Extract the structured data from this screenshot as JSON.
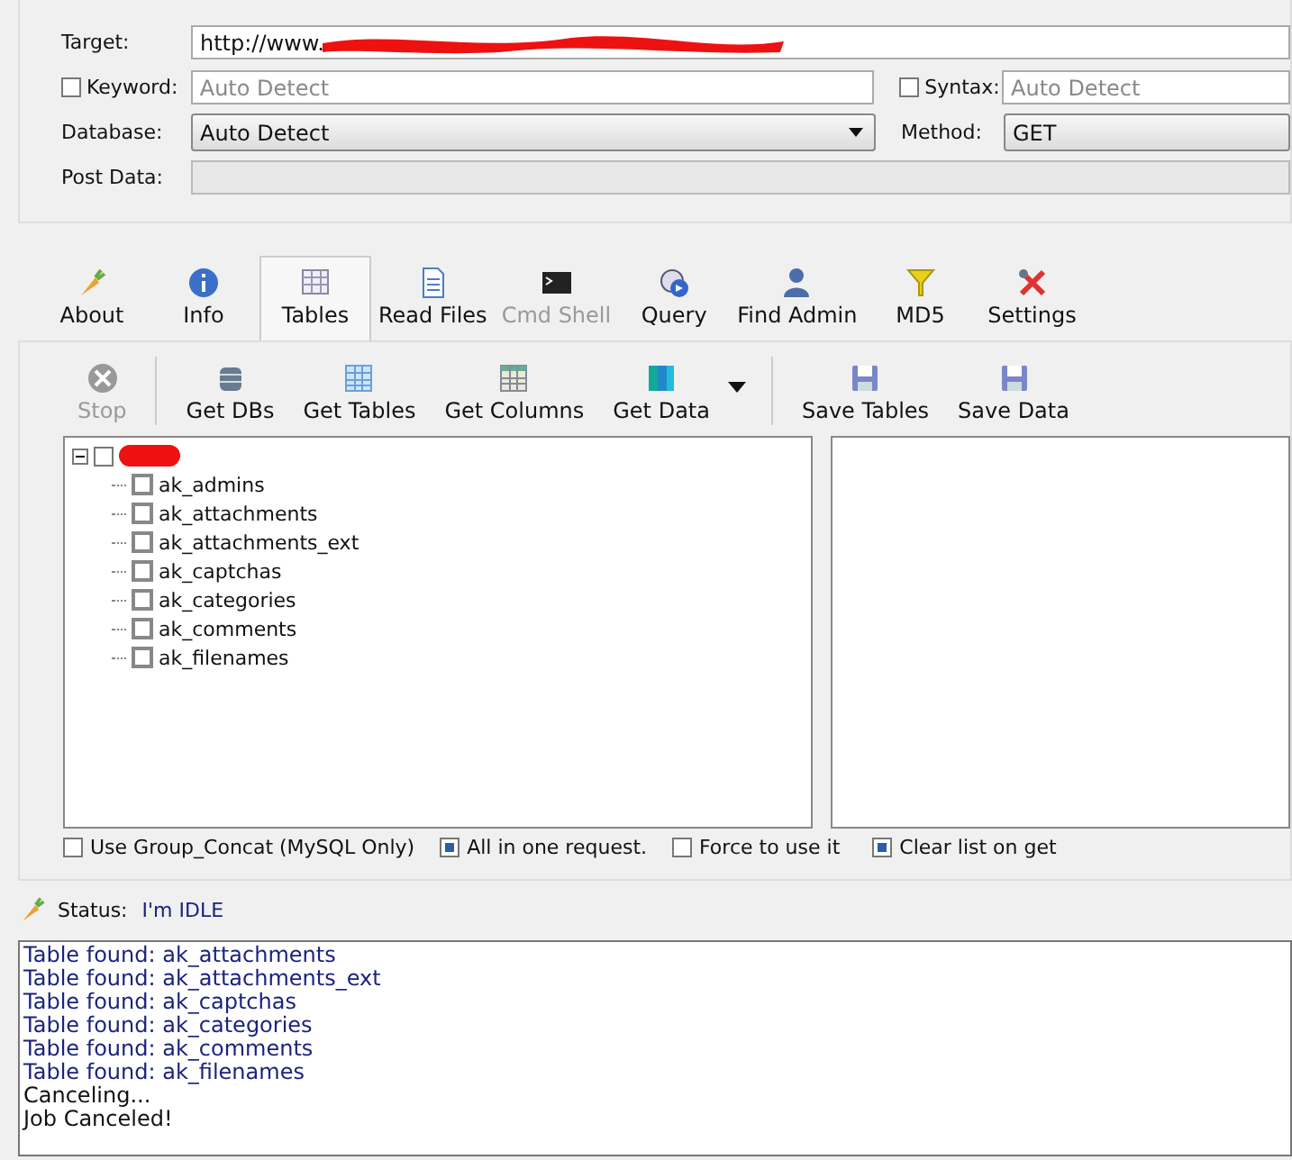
{
  "form": {
    "target": {
      "label": "Target:",
      "value": "http://www."
    },
    "keyword": {
      "label": "Keyword:",
      "checked": false,
      "placeholder": "Auto Detect"
    },
    "syntax": {
      "label": "Syntax:",
      "checked": false,
      "placeholder": "Auto Detect"
    },
    "database": {
      "label": "Database:",
      "value": "Auto Detect"
    },
    "method": {
      "label": "Method:",
      "value": "GET"
    },
    "post_data": {
      "label": "Post Data:",
      "disabled": true
    }
  },
  "tabs": [
    {
      "label": "About",
      "selected": false,
      "disabled": false,
      "kind": "carrot"
    },
    {
      "label": "Info",
      "selected": false,
      "disabled": false,
      "kind": "info"
    },
    {
      "label": "Tables",
      "selected": true,
      "disabled": false,
      "kind": "table"
    },
    {
      "label": "Read Files",
      "selected": false,
      "disabled": false,
      "kind": "file"
    },
    {
      "label": "Cmd Shell",
      "selected": false,
      "disabled": true,
      "kind": "terminal"
    },
    {
      "label": "Query",
      "selected": false,
      "disabled": false,
      "kind": "query"
    },
    {
      "label": "Find Admin",
      "selected": false,
      "disabled": false,
      "kind": "user"
    },
    {
      "label": "MD5",
      "selected": false,
      "disabled": false,
      "kind": "funnel"
    },
    {
      "label": "Settings",
      "selected": false,
      "disabled": false,
      "kind": "tools"
    }
  ],
  "toolbar": [
    {
      "label": "Stop",
      "disabled": true,
      "kind": "stop"
    },
    {
      "kind": "sep"
    },
    {
      "label": "Get DBs",
      "disabled": false,
      "kind": "db"
    },
    {
      "label": "Get Tables",
      "disabled": false,
      "kind": "grid"
    },
    {
      "label": "Get Columns",
      "disabled": false,
      "kind": "columns"
    },
    {
      "label": "Get Data",
      "disabled": false,
      "kind": "data"
    },
    {
      "kind": "dropdown"
    },
    {
      "kind": "sep"
    },
    {
      "label": "Save Tables",
      "disabled": false,
      "kind": "save"
    },
    {
      "label": "Save Data",
      "disabled": false,
      "kind": "save"
    }
  ],
  "tree": {
    "root": {
      "checked": false,
      "expanded": true,
      "redacted": true
    },
    "children": [
      {
        "label": "ak_admins",
        "checked": false
      },
      {
        "label": "ak_attachments",
        "checked": false
      },
      {
        "label": "ak_attachments_ext",
        "checked": false
      },
      {
        "label": "ak_captchas",
        "checked": false
      },
      {
        "label": "ak_categories",
        "checked": false
      },
      {
        "label": "ak_comments",
        "checked": false
      },
      {
        "label": "ak_filenames",
        "checked": false
      }
    ]
  },
  "options": [
    {
      "label": "Use Group_Concat (MySQL Only)",
      "checked": false
    },
    {
      "label": "All in one request.",
      "checked": true
    },
    {
      "label": "Force to use it",
      "checked": false
    },
    {
      "label": "Clear list on get",
      "checked": true
    }
  ],
  "status": {
    "label": "Status:",
    "value": "I'm IDLE"
  },
  "log": [
    {
      "text": "Table found: ak_attachments",
      "kind": "found"
    },
    {
      "text": "Table found: ak_attachments_ext",
      "kind": "found"
    },
    {
      "text": "Table found: ak_captchas",
      "kind": "found"
    },
    {
      "text": "Table found: ak_categories",
      "kind": "found"
    },
    {
      "text": "Table found: ak_comments",
      "kind": "found"
    },
    {
      "text": "Table found: ak_filenames",
      "kind": "found"
    },
    {
      "text": "Canceling...",
      "kind": "info"
    },
    {
      "text": "Job Canceled!",
      "kind": "info"
    }
  ]
}
